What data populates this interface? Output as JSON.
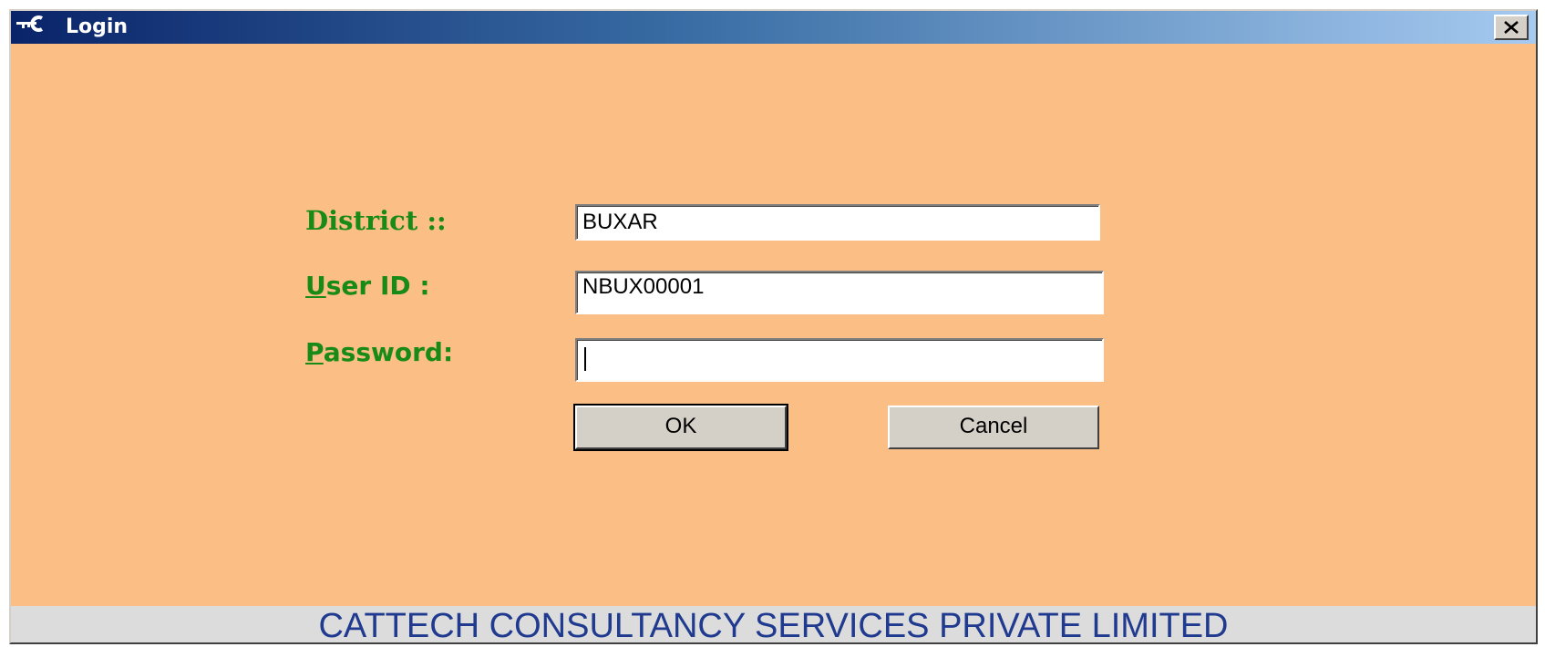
{
  "window": {
    "title": "Login",
    "close_label": "X"
  },
  "form": {
    "district_label": "District ::",
    "district_value": "BUXAR",
    "userid_mnemonic": "U",
    "userid_label_rest": "ser ID :",
    "userid_value": "NBUX00001",
    "password_mnemonic": "P",
    "password_label_rest": "assword:",
    "password_value": ""
  },
  "buttons": {
    "ok_label": "OK",
    "cancel_label": "Cancel"
  },
  "footer": {
    "text": "CATTECH CONSULTANCY SERVICES PRIVATE LIMITED"
  },
  "colors": {
    "window_bg": "#FBBF85",
    "label_green": "#178A17",
    "footer_blue": "#1F3A8F",
    "titlebar_start": "#0A246A",
    "titlebar_end": "#A6CAF0"
  },
  "icons": {
    "title": "app-key-icon",
    "close": "close-x-icon"
  }
}
